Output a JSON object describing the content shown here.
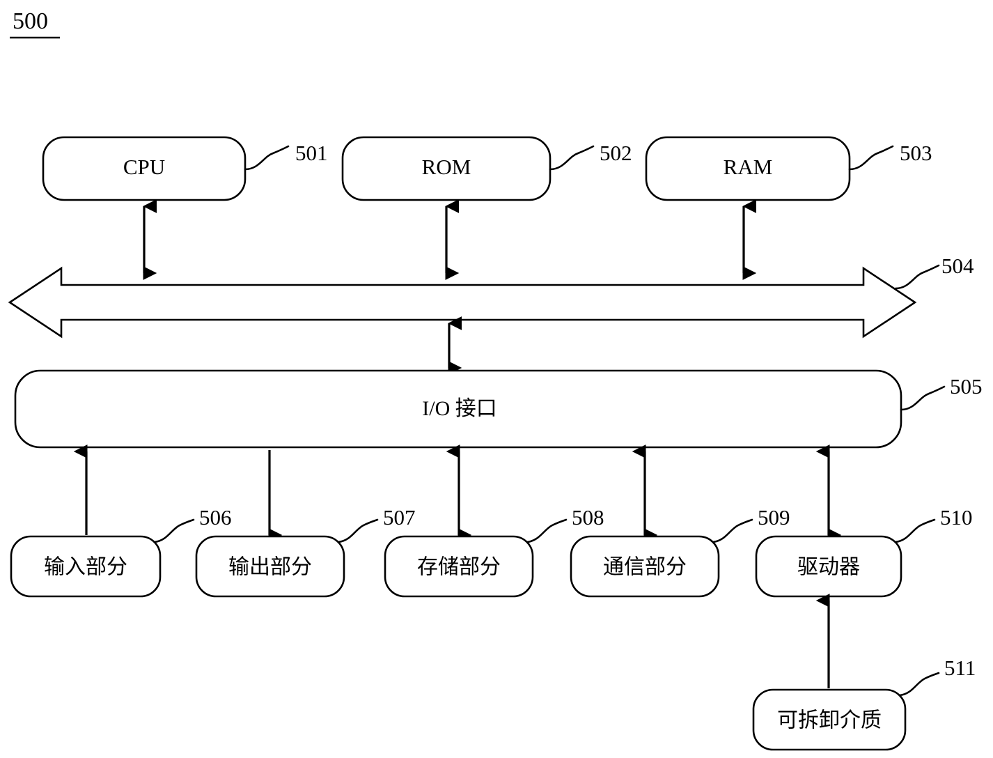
{
  "figure": {
    "number": "500",
    "title_underlined": true
  },
  "diagram": {
    "type": "block-diagram",
    "description": "Computer system architecture block diagram",
    "blocks": [
      {
        "id": "cpu",
        "label": "CPU",
        "ref": "501"
      },
      {
        "id": "rom",
        "label": "ROM",
        "ref": "502"
      },
      {
        "id": "ram",
        "label": "RAM",
        "ref": "503"
      },
      {
        "id": "bus",
        "label": "",
        "ref": "504"
      },
      {
        "id": "io",
        "label": "I/O 接口",
        "ref": "505"
      },
      {
        "id": "input",
        "label": "输入部分",
        "ref": "506"
      },
      {
        "id": "output",
        "label": "输出部分",
        "ref": "507"
      },
      {
        "id": "storage",
        "label": "存储部分",
        "ref": "508"
      },
      {
        "id": "comm",
        "label": "通信部分",
        "ref": "509"
      },
      {
        "id": "driver",
        "label": "驱动器",
        "ref": "510"
      },
      {
        "id": "media",
        "label": "可拆卸介质",
        "ref": "511"
      }
    ],
    "connections": [
      {
        "from": "cpu",
        "to": "bus",
        "direction": "bidirectional"
      },
      {
        "from": "rom",
        "to": "bus",
        "direction": "bidirectional"
      },
      {
        "from": "ram",
        "to": "bus",
        "direction": "bidirectional"
      },
      {
        "from": "bus",
        "to": "io",
        "direction": "bidirectional"
      },
      {
        "from": "input",
        "to": "io",
        "direction": "up"
      },
      {
        "from": "io",
        "to": "output",
        "direction": "down"
      },
      {
        "from": "storage",
        "to": "io",
        "direction": "bidirectional"
      },
      {
        "from": "comm",
        "to": "io",
        "direction": "bidirectional"
      },
      {
        "from": "driver",
        "to": "io",
        "direction": "bidirectional"
      },
      {
        "from": "media",
        "to": "driver",
        "direction": "up"
      }
    ],
    "colors": {
      "stroke": "#000000",
      "fill": "#ffffff",
      "background": "#ffffff"
    }
  }
}
